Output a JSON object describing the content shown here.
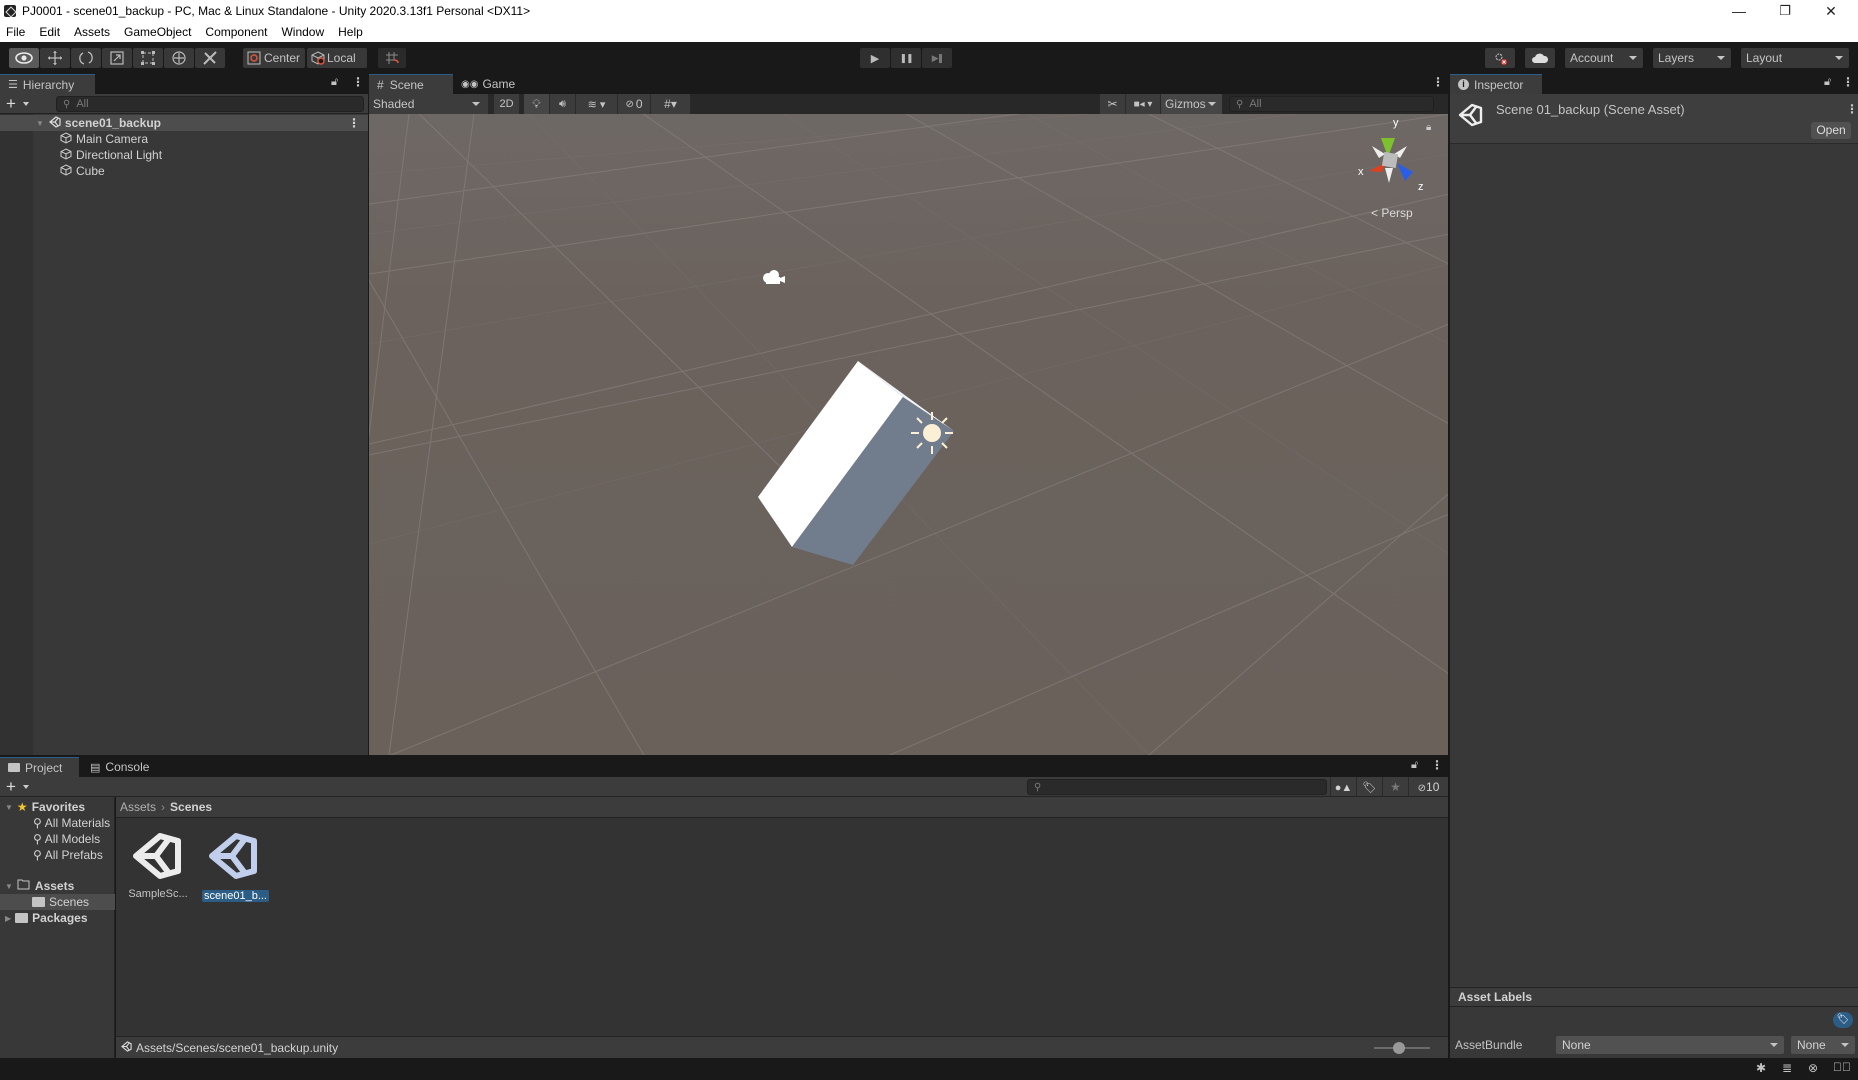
{
  "window": {
    "title": "PJ0001 - scene01_backup - PC, Mac & Linux Standalone - Unity 2020.3.13f1 Personal <DX11>",
    "controls": {
      "minimize": "—",
      "restore": "❐",
      "close": "✕"
    }
  },
  "menu": [
    "File",
    "Edit",
    "Assets",
    "GameObject",
    "Component",
    "Window",
    "Help"
  ],
  "toolbar": {
    "tools": [
      {
        "name": "view-tool",
        "icon": "eye-icon",
        "active": true
      },
      {
        "name": "move-tool",
        "icon": "move-icon"
      },
      {
        "name": "rotate-tool",
        "icon": "rotate-icon"
      },
      {
        "name": "scale-tool",
        "icon": "scale-icon"
      },
      {
        "name": "rect-tool",
        "icon": "rect-icon"
      },
      {
        "name": "transform-tool",
        "icon": "transform-icon"
      },
      {
        "name": "custom-tool",
        "icon": "tools-icon"
      }
    ],
    "pivot_mode": "Center",
    "pivot_rotation": "Local",
    "play_label": "▶",
    "pause_label": "❚❚",
    "step_label": "▶❚",
    "account_label": "Account",
    "layers_label": "Layers",
    "layout_label": "Layout"
  },
  "hierarchy": {
    "tab_label": "Hierarchy",
    "search_placeholder": "All",
    "scene_name": "scene01_backup",
    "items": [
      "Main Camera",
      "Directional Light",
      "Cube"
    ]
  },
  "scene": {
    "tabs": [
      {
        "label": "Scene",
        "active": true
      },
      {
        "label": "Game",
        "active": false
      }
    ],
    "shading_mode": "Shaded",
    "mode_2d": "2D",
    "hidden_count": "0",
    "gizmos_label": "Gizmos",
    "search_placeholder": "All",
    "projection_label": "Persp",
    "axis_labels": {
      "x": "x",
      "y": "y",
      "z": "z"
    }
  },
  "inspector": {
    "tab_label": "Inspector",
    "asset_title": "Scene 01_backup (Scene Asset)",
    "open_label": "Open",
    "asset_labels_header": "Asset Labels",
    "assetbundle_label": "AssetBundle",
    "assetbundle_value": "None",
    "assetbundle_variant": "None"
  },
  "project": {
    "tabs": [
      {
        "label": "Project",
        "active": true
      },
      {
        "label": "Console",
        "active": false
      }
    ],
    "hidden_packages_count": "10",
    "breadcrumb": [
      "Assets",
      "Scenes"
    ],
    "tree": {
      "favorites": {
        "label": "Favorites",
        "items": [
          "All Materials",
          "All Models",
          "All Prefabs"
        ]
      },
      "assets": {
        "label": "Assets",
        "children": [
          "Scenes"
        ]
      },
      "packages": {
        "label": "Packages"
      }
    },
    "files": [
      {
        "label": "SampleSc...",
        "selected": false
      },
      {
        "label": "scene01_b...",
        "selected": true
      }
    ],
    "selected_path": "Assets/Scenes/scene01_backup.unity",
    "icon_size_fraction": 0.45
  },
  "colors": {
    "accent_selection": "#2c5d87",
    "scene_background": "#6b625d",
    "panel_background": "#383838",
    "toolbar_background": "#191919"
  }
}
